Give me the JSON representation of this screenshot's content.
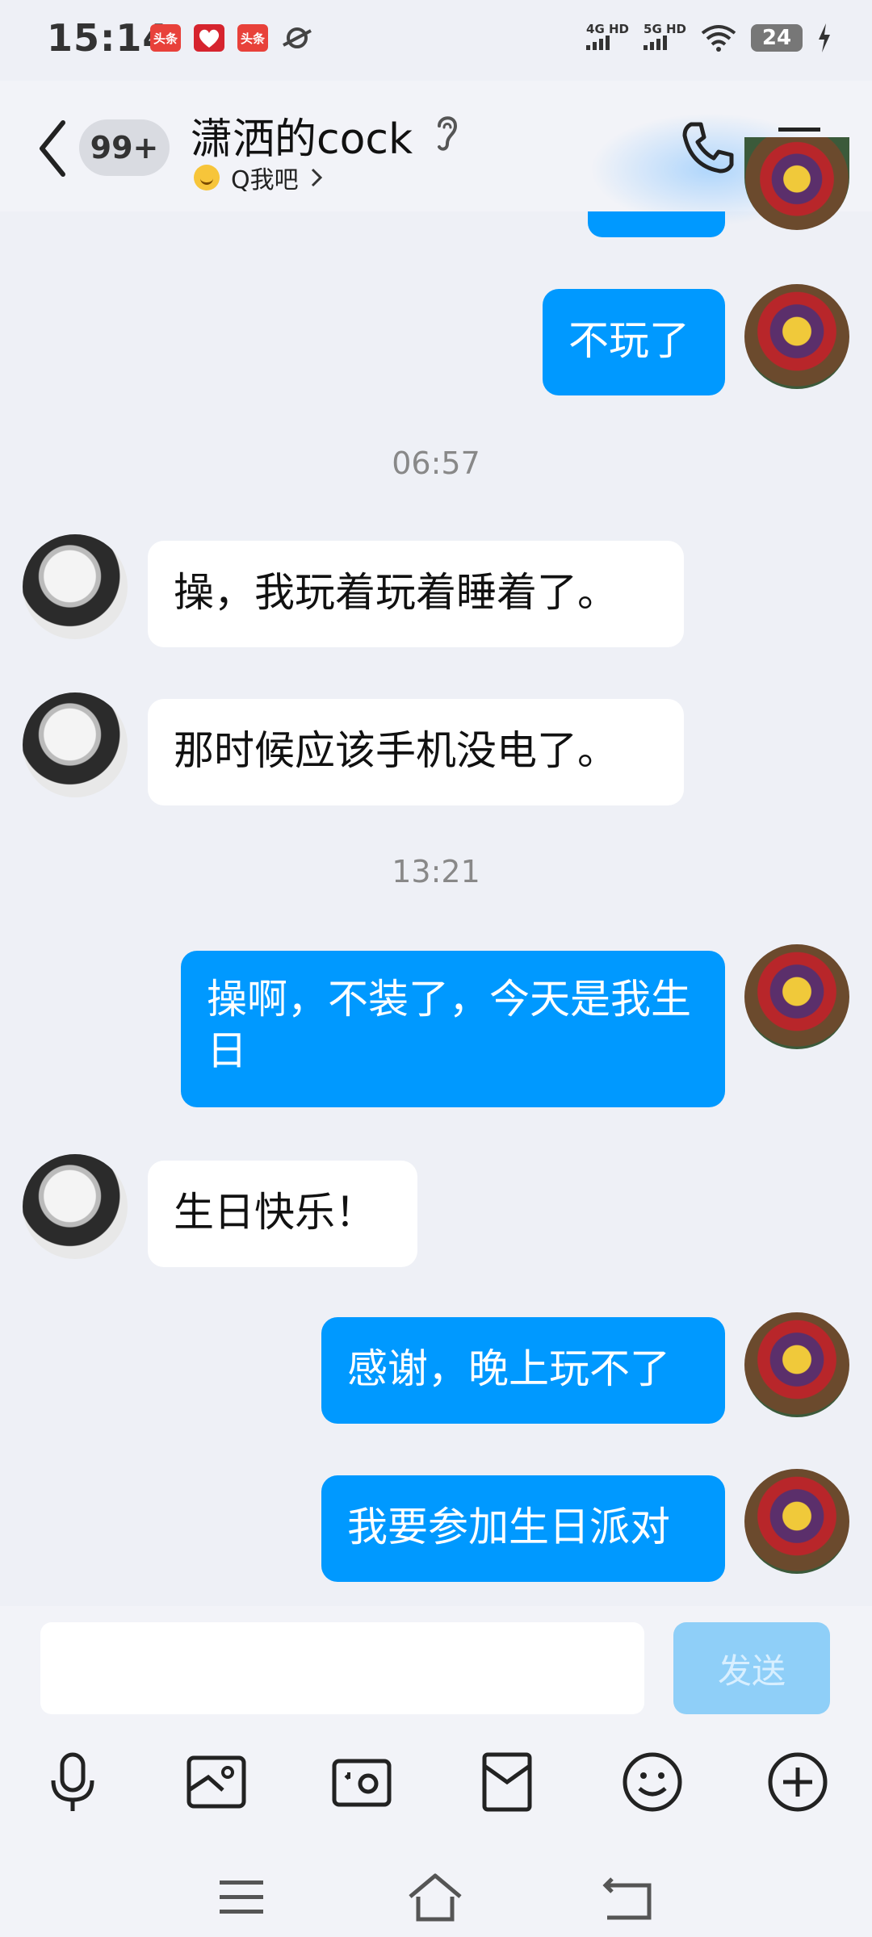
{
  "status_bar": {
    "time": "15:14",
    "app_icons": [
      "头条",
      "头条"
    ],
    "net1": "4G HD",
    "net2": "5G HD",
    "battery": "24"
  },
  "header": {
    "unread_badge": "99+",
    "title": "潇洒的cock",
    "subtitle": "Q我吧",
    "icons": [
      "back-arrow-icon",
      "ear-icon",
      "phone-icon",
      "menu-icon"
    ]
  },
  "messages": [
    {
      "side": "out",
      "text": "不玩了"
    },
    {
      "type": "time",
      "text": "06:57"
    },
    {
      "side": "in",
      "text": "操，我玩着玩着睡着了。"
    },
    {
      "side": "in",
      "text": "那时候应该手机没电了。"
    },
    {
      "type": "time",
      "text": "13:21"
    },
    {
      "side": "out",
      "text": "操啊，不装了，今天是我生日"
    },
    {
      "side": "in",
      "text": "生日快乐！"
    },
    {
      "side": "out",
      "text": "感谢，晚上玩不了"
    },
    {
      "side": "out",
      "text": "我要参加生日派对"
    }
  ],
  "composer": {
    "input_value": "",
    "send_label": "发送",
    "tools": [
      "microphone-icon",
      "image-icon",
      "camera-icon",
      "red-packet-icon",
      "emoji-icon",
      "plus-icon"
    ]
  },
  "nav_bar": [
    "menu-icon",
    "home-icon",
    "back-icon"
  ],
  "colors": {
    "accent": "#0099ff",
    "background": "#eef0f6",
    "send_disabled": "#8fcff8"
  }
}
